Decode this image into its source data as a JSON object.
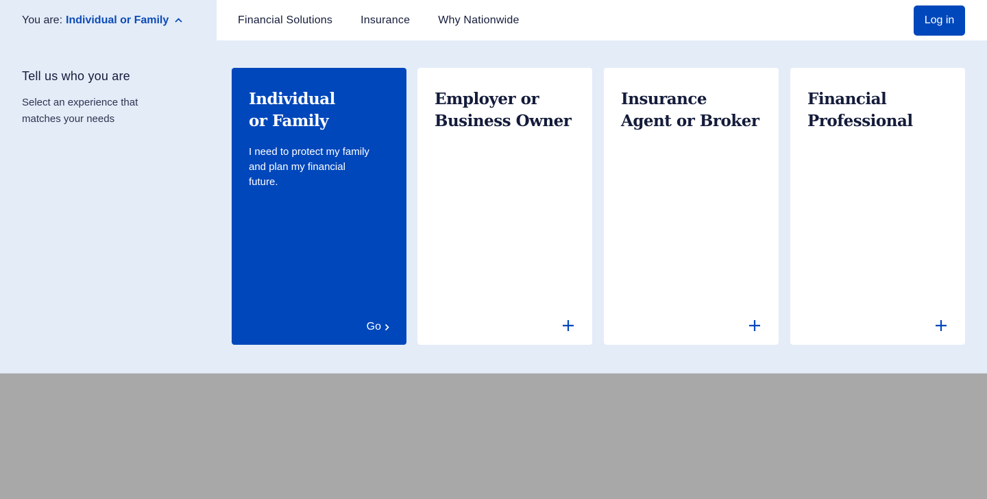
{
  "header": {
    "audience_prefix": "You are:",
    "audience_current": "Individual or Family",
    "nav": [
      "Financial Solutions",
      "Insurance",
      "Why Nationwide"
    ],
    "login_label": "Log in"
  },
  "selector": {
    "heading": "Tell us who you are",
    "subtext": "Select an experience that matches your needs",
    "cards": [
      {
        "title_line1": "Individual",
        "title_line2": "or Family",
        "description": "I need to protect my family and plan my financial future.",
        "action_label": "Go",
        "selected": true
      },
      {
        "title_line1": "Employer or",
        "title_line2": "Business Owner",
        "selected": false
      },
      {
        "title_line1": "Insurance",
        "title_line2": "Agent or Broker",
        "selected": false
      },
      {
        "title_line1": "Financial",
        "title_line2": "Professional",
        "selected": false
      }
    ]
  },
  "colors": {
    "brand_blue": "#0047bb",
    "panel_bg": "#e4ecf8",
    "overlay_gray": "#a8a8a8",
    "text_dark": "#141b3a"
  },
  "icons": {
    "toggle": "chevron-up-icon",
    "card_go": "chevron-right-icon",
    "card_expand": "plus-icon"
  }
}
